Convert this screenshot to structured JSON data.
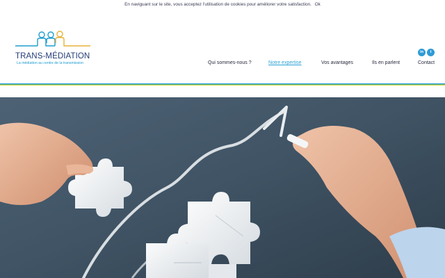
{
  "cookie_bar": {
    "text": "En naviguant sur le site, vous acceptez l'utilisation de cookies pour améliorer votre satisfaction.",
    "ok_label": "Ok"
  },
  "logo": {
    "title": "TRANS-MÉDIATION",
    "subtitle": "La médiation au centre de la transmission",
    "colors": {
      "blue": "#1f9dd0",
      "yellow": "#e7b23a",
      "navy": "#233b78"
    }
  },
  "nav": {
    "items": [
      {
        "label": "Qui sommes-nous ?",
        "active": false
      },
      {
        "label": "Notre expertise",
        "active": true
      },
      {
        "label": "Vos avantages",
        "active": false
      },
      {
        "label": "Ils en parlent",
        "active": false
      },
      {
        "label": "Contact",
        "active": false
      }
    ],
    "active_color": "#2ea3d6"
  },
  "social": [
    {
      "icon": "linkedin-icon",
      "glyph": "in"
    },
    {
      "icon": "twitter-icon",
      "glyph": "t"
    }
  ],
  "divider_colors": [
    "#1d9ad6",
    "#c8d63c"
  ],
  "hero": {
    "image": "hands-puzzle-chalk-arrow-photo"
  }
}
